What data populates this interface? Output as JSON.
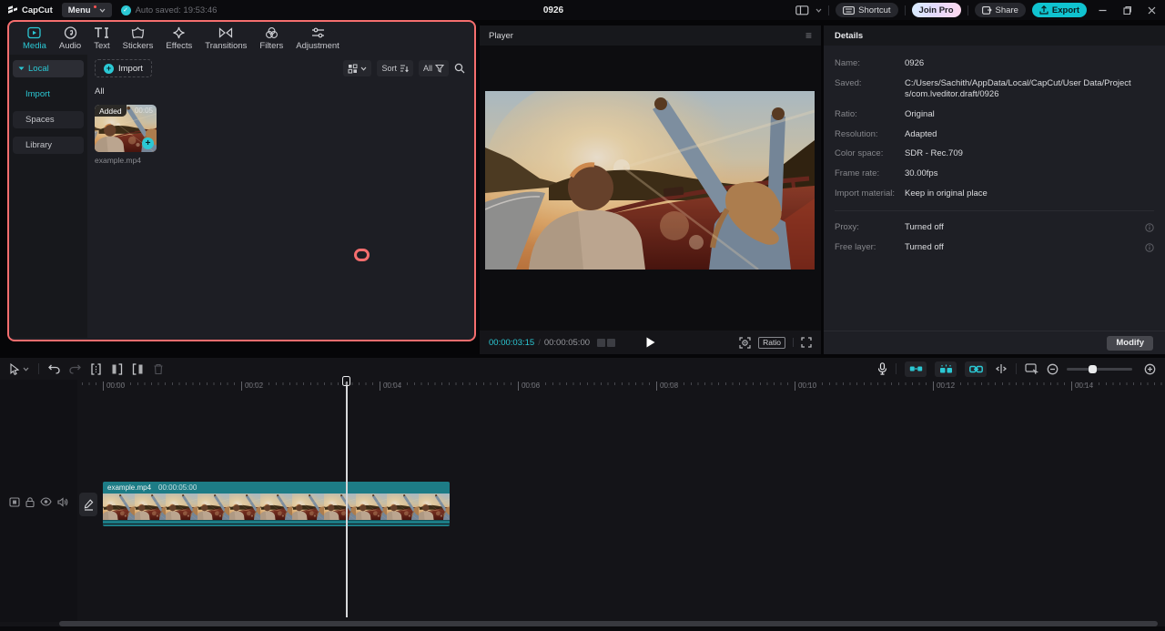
{
  "colors": {
    "teal": "#2bc8d4",
    "coral": "#f56e6e",
    "export_bg": "#10c3d0",
    "clip_teal": "#1d7c86"
  },
  "icons": {
    "check": "✓",
    "plus": "+",
    "hamburger": "≡",
    "info": "?"
  },
  "titlebar": {
    "app_name": "CapCut",
    "menu_label": "Menu",
    "autosave_text": "Auto saved: 19:53:46",
    "project_title": "0926",
    "shortcut_label": "Shortcut",
    "join_pro_label": "Join Pro",
    "share_label": "Share",
    "export_label": "Export"
  },
  "media_panel": {
    "tabs": [
      {
        "label": "Media",
        "selected": true
      },
      {
        "label": "Audio"
      },
      {
        "label": "Text"
      },
      {
        "label": "Stickers"
      },
      {
        "label": "Effects"
      },
      {
        "label": "Transitions"
      },
      {
        "label": "Filters"
      },
      {
        "label": "Adjustment"
      }
    ],
    "sidebar": {
      "group_label": "Local",
      "items": [
        {
          "label": "Import",
          "selected": true
        },
        {
          "label": "Spaces"
        },
        {
          "label": "Library"
        }
      ]
    },
    "toolbar": {
      "import_label": "Import",
      "sort_label": "Sort",
      "filter_label": "All"
    },
    "section_label": "All",
    "clip": {
      "badge": "Added",
      "duration": "00:05",
      "name": "example.mp4"
    }
  },
  "player": {
    "title": "Player",
    "current_time": "00:00:03:15",
    "time_separator": "/",
    "total_time": "00:00:05:00",
    "ratio_label": "Ratio"
  },
  "details": {
    "title": "Details",
    "rows": [
      {
        "label": "Name:",
        "value": "0926"
      },
      {
        "label": "Saved:",
        "value": "C:/Users/Sachith/AppData/Local/CapCut/User Data/Projects/com.lveditor.draft/0926"
      },
      {
        "label": "Ratio:",
        "value": "Original"
      },
      {
        "label": "Resolution:",
        "value": "Adapted"
      },
      {
        "label": "Color space:",
        "value": "SDR - Rec.709"
      },
      {
        "label": "Frame rate:",
        "value": "30.00fps"
      },
      {
        "label": "Import material:",
        "value": "Keep in original place"
      },
      {
        "label": "Proxy:",
        "value": "Turned off",
        "has_info": true
      },
      {
        "label": "Free layer:",
        "value": "Turned off",
        "has_info": true
      }
    ],
    "modify_label": "Modify"
  },
  "timeline": {
    "ruler_labels": [
      "00:00",
      "00:02",
      "00:04",
      "00:06",
      "00:08",
      "00:10",
      "00:12",
      "00:14"
    ],
    "clip_name": "example.mp4",
    "clip_duration": "00:00:05:00"
  }
}
